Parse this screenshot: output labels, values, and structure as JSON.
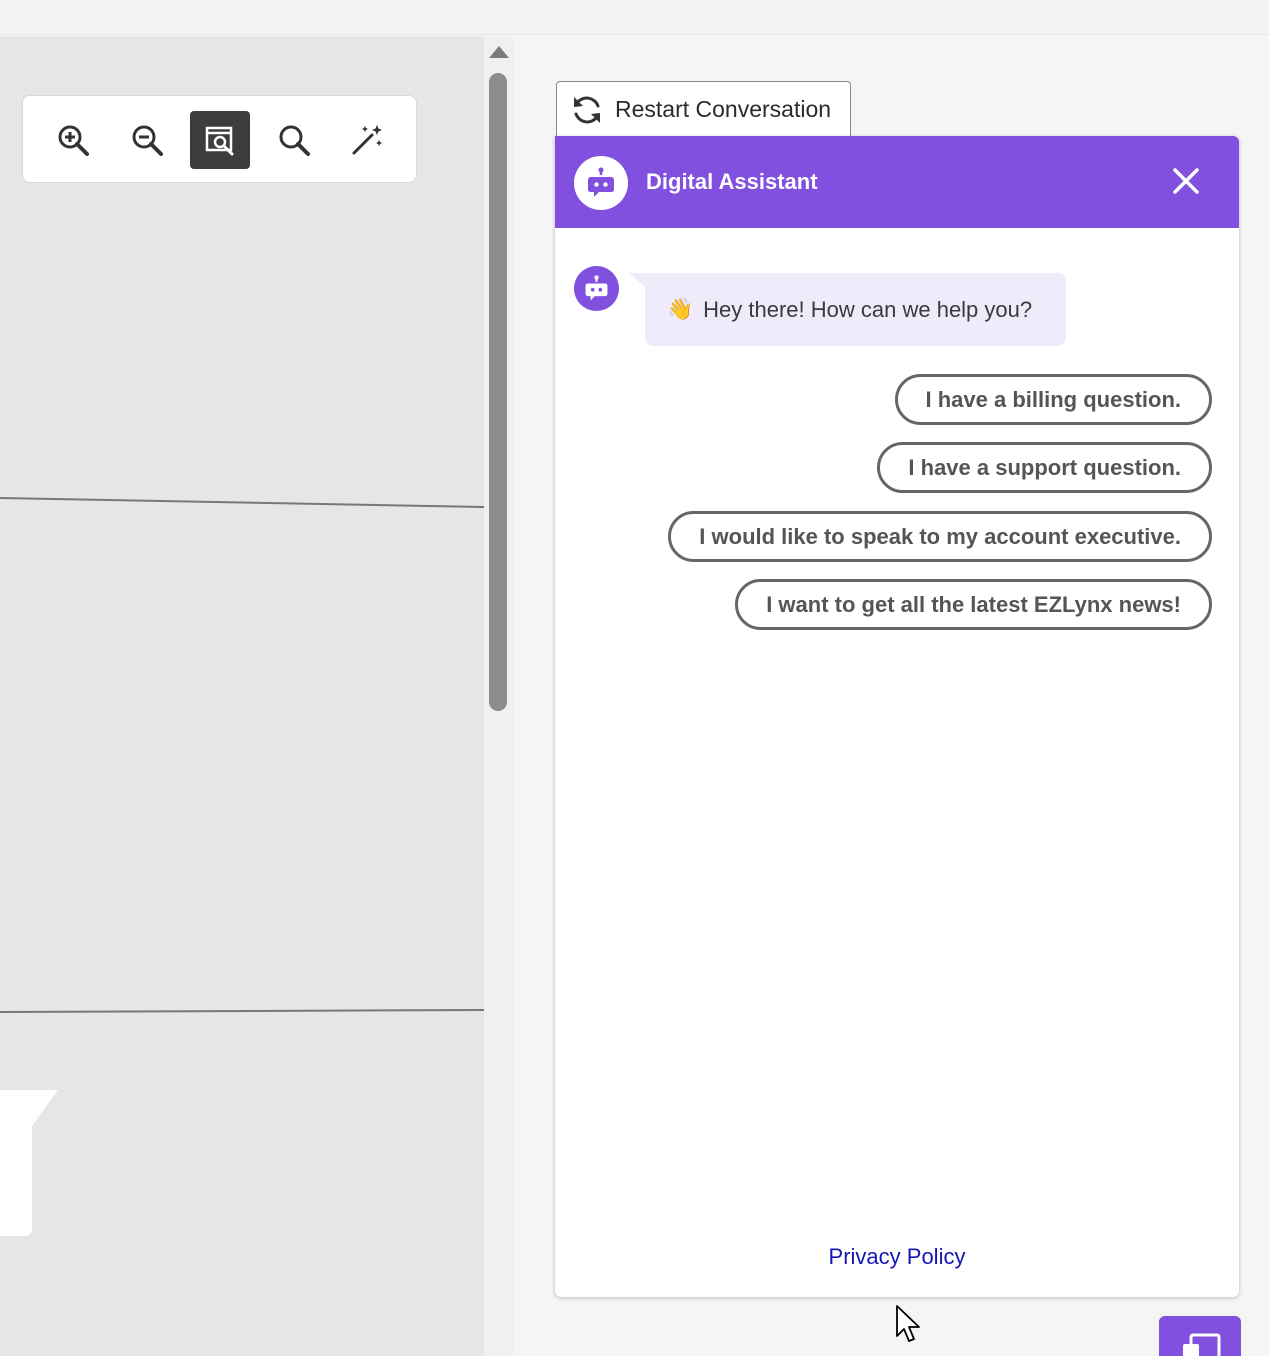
{
  "restart_button": {
    "label": "Restart Conversation"
  },
  "chat": {
    "title": "Digital Assistant",
    "greeting": {
      "emoji": "👋",
      "text": "Hey there! How can we help you?"
    },
    "quick_replies": [
      "I have a billing question.",
      "I have a support question.",
      "I would like to speak to my account executive.",
      "I want to get all the latest EZLynx news!"
    ],
    "privacy_link": "Privacy Policy"
  },
  "toolbar": {
    "tools": [
      "zoom-in-icon",
      "zoom-out-icon",
      "zoom-to-fit-icon",
      "search-icon",
      "magic-wand-icon"
    ],
    "active_tool": "zoom-to-fit-icon"
  },
  "colors": {
    "brand_purple": "#8150df",
    "bubble_bg": "#efebfb",
    "link_blue": "#1515b8",
    "canvas_bg": "#e6e6e6"
  }
}
